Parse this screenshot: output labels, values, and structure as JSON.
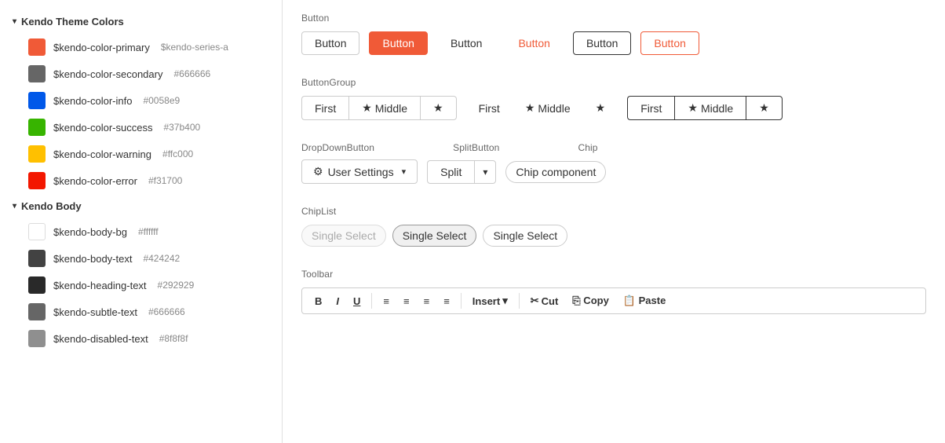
{
  "sidebar": {
    "sections": [
      {
        "id": "kendo-theme-colors",
        "label": "Kendo Theme Colors",
        "expanded": true,
        "items": [
          {
            "name": "$kendo-color-primary",
            "alias": "$kendo-series-a",
            "color": "#f05a37"
          },
          {
            "name": "$kendo-color-secondary",
            "alias": "#666666",
            "color": "#666666"
          },
          {
            "name": "$kendo-color-info",
            "alias": "#0058e9",
            "color": "#0058e9"
          },
          {
            "name": "$kendo-color-success",
            "alias": "#37b400",
            "color": "#37b400"
          },
          {
            "name": "$kendo-color-warning",
            "alias": "#ffc000",
            "color": "#ffc000"
          },
          {
            "name": "$kendo-color-error",
            "alias": "#f31700",
            "color": "#f31700"
          }
        ]
      },
      {
        "id": "kendo-body",
        "label": "Kendo Body",
        "expanded": true,
        "items": [
          {
            "name": "$kendo-body-bg",
            "alias": "#ffffff",
            "color": "#ffffff"
          },
          {
            "name": "$kendo-body-text",
            "alias": "#424242",
            "color": "#424242"
          },
          {
            "name": "$kendo-heading-text",
            "alias": "#292929",
            "color": "#292929"
          },
          {
            "name": "$kendo-subtle-text",
            "alias": "#666666",
            "color": "#666666"
          },
          {
            "name": "$kendo-disabled-text",
            "alias": "#8f8f8f",
            "color": "#8f8f8f"
          }
        ]
      }
    ]
  },
  "main": {
    "button_section": {
      "label": "Button",
      "buttons": [
        {
          "id": "btn1",
          "label": "Button",
          "style": "default"
        },
        {
          "id": "btn2",
          "label": "Button",
          "style": "primary"
        },
        {
          "id": "btn3",
          "label": "Button",
          "style": "flat-text"
        },
        {
          "id": "btn4",
          "label": "Button",
          "style": "link-red"
        },
        {
          "id": "btn5",
          "label": "Button",
          "style": "bordered"
        },
        {
          "id": "btn6",
          "label": "Button",
          "style": "outline-red"
        }
      ]
    },
    "button_group_section": {
      "label": "ButtonGroup",
      "groups": [
        {
          "id": "bg1",
          "style": "default",
          "items": [
            {
              "label": "First",
              "type": "text"
            },
            {
              "label": "Middle",
              "type": "text-icon"
            },
            {
              "label": "★",
              "type": "icon"
            }
          ]
        },
        {
          "id": "bg2",
          "style": "flat",
          "items": [
            {
              "label": "First",
              "type": "text"
            },
            {
              "label": "Middle",
              "type": "text-icon"
            },
            {
              "label": "★",
              "type": "icon"
            }
          ]
        },
        {
          "id": "bg3",
          "style": "bordered",
          "items": [
            {
              "label": "First",
              "type": "text"
            },
            {
              "label": "Middle",
              "type": "text-icon"
            },
            {
              "label": "★",
              "type": "icon"
            }
          ]
        }
      ]
    },
    "dropdown_section": {
      "label": "DropDownButton",
      "button_label": "User Settings",
      "icon": "gear"
    },
    "split_section": {
      "label": "SplitButton",
      "main_label": "Split",
      "arrow": "▾"
    },
    "chip_section": {
      "label": "Chip",
      "chip_label": "Chip component"
    },
    "chiplist_section": {
      "label": "ChipList",
      "chips": [
        {
          "id": "c1",
          "label": "Single Select",
          "style": "disabled"
        },
        {
          "id": "c2",
          "label": "Single Select",
          "style": "selected"
        },
        {
          "id": "c3",
          "label": "Single Select",
          "style": "default"
        }
      ]
    },
    "toolbar_section": {
      "label": "Toolbar",
      "buttons": [
        {
          "id": "tb1",
          "label": "B",
          "title": "Bold"
        },
        {
          "id": "tb2",
          "label": "I",
          "title": "Italic"
        },
        {
          "id": "tb3",
          "label": "U",
          "title": "Underline"
        }
      ]
    }
  }
}
